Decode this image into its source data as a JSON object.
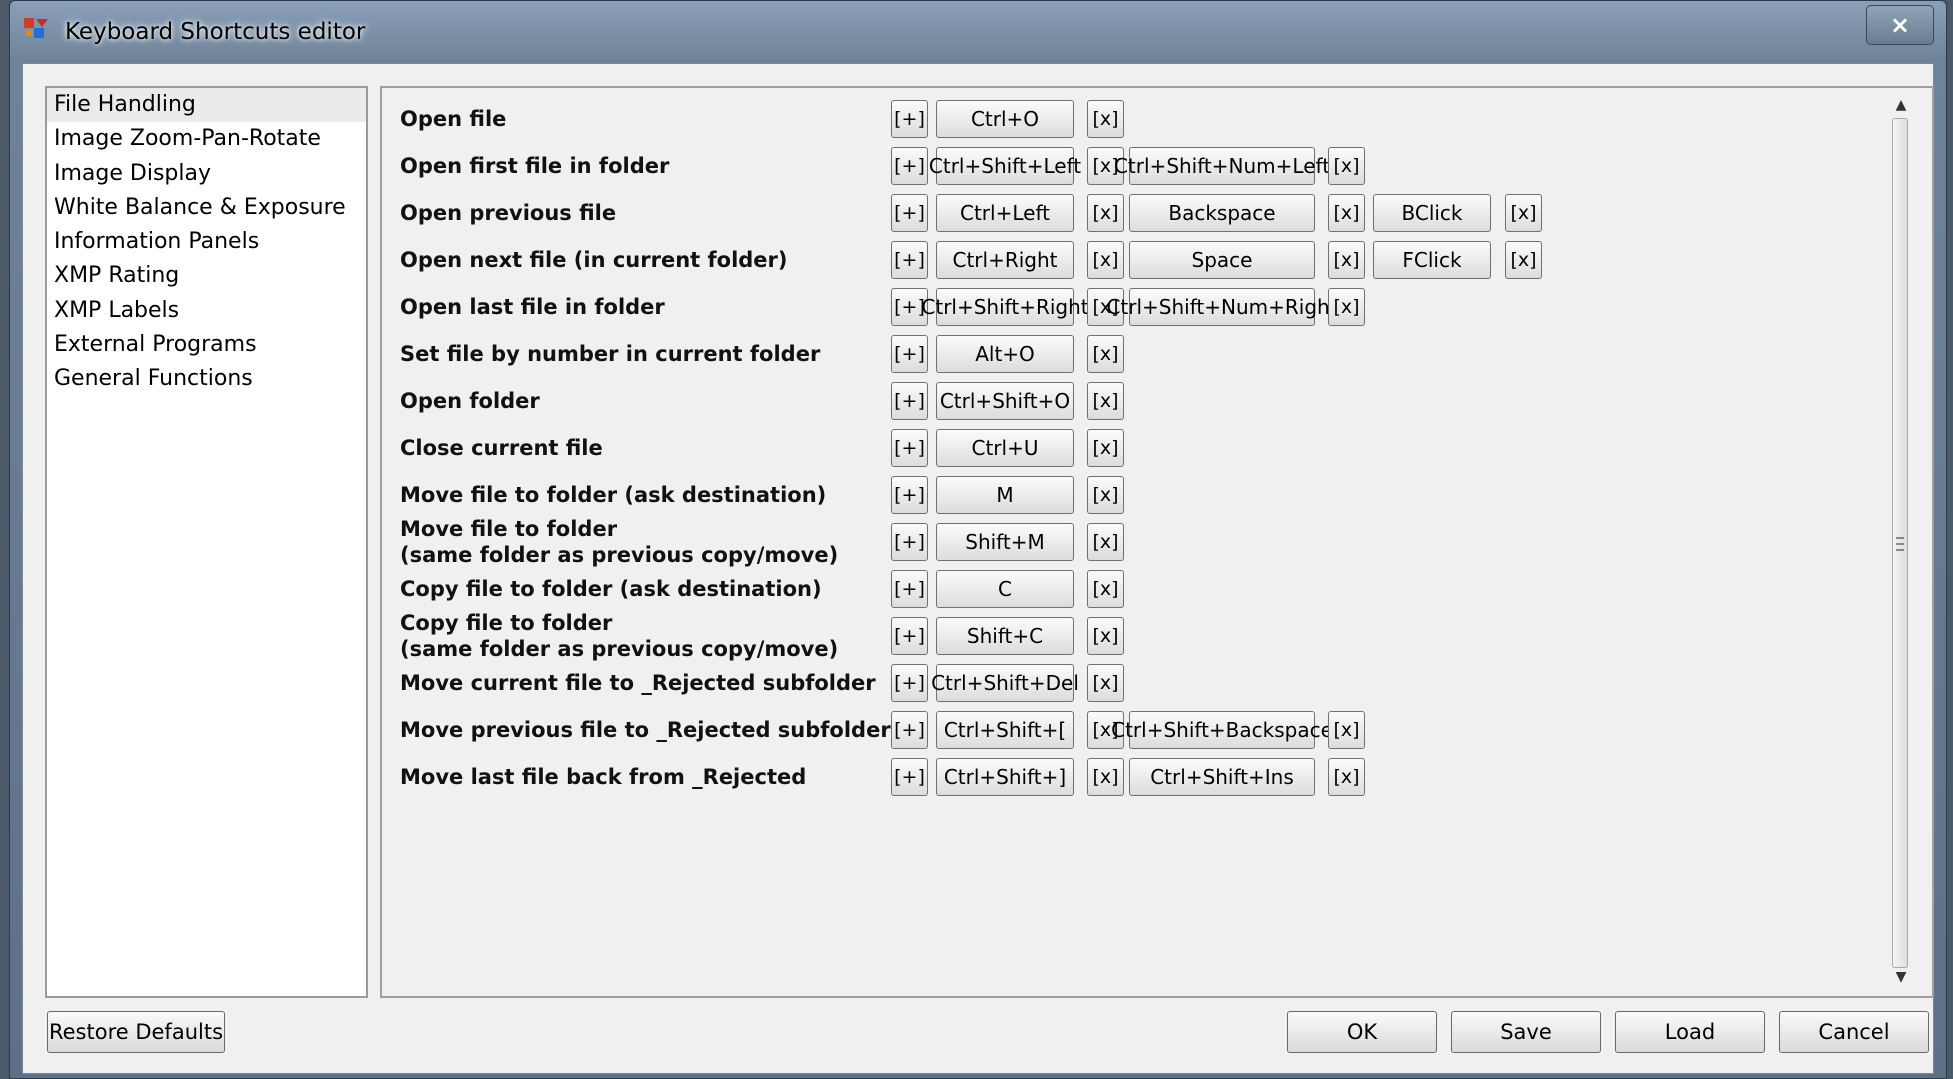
{
  "window": {
    "title": "Keyboard Shortcuts editor",
    "close_label": "×"
  },
  "categories": [
    "File Handling",
    "Image Zoom-Pan-Rotate",
    "Image Display",
    "White Balance & Exposure",
    "Information Panels",
    "XMP Rating",
    "XMP Labels",
    "External Programs",
    "General Functions"
  ],
  "selected_category": "File Handling",
  "add_label": "[+]",
  "remove_label": "[x]",
  "shortcuts": [
    {
      "label": "Open file",
      "keys": [
        "Ctrl+O"
      ]
    },
    {
      "label": "Open first file in folder",
      "keys": [
        "Ctrl+Shift+Left",
        "Ctrl+Shift+Num+Left"
      ]
    },
    {
      "label": "Open previous file",
      "keys": [
        "Ctrl+Left",
        "Backspace",
        "BClick"
      ]
    },
    {
      "label": "Open next file (in current folder)",
      "keys": [
        "Ctrl+Right",
        "Space",
        "FClick"
      ]
    },
    {
      "label": "Open last file in folder",
      "keys": [
        "Ctrl+Shift+Right",
        "Ctrl+Shift+Num+Right"
      ]
    },
    {
      "label": "Set file by number in current folder",
      "keys": [
        "Alt+O"
      ]
    },
    {
      "label": "Open folder",
      "keys": [
        "Ctrl+Shift+O"
      ]
    },
    {
      "label": "Close current file",
      "keys": [
        "Ctrl+U"
      ]
    },
    {
      "label": "Move file to folder (ask destination)",
      "keys": [
        "M"
      ]
    },
    {
      "label": "Move file to folder\n(same folder as previous copy/move)",
      "keys": [
        "Shift+M"
      ]
    },
    {
      "label": "Copy file to folder (ask destination)",
      "keys": [
        "C"
      ]
    },
    {
      "label": "Copy file to folder\n(same folder as previous copy/move)",
      "keys": [
        "Shift+C"
      ]
    },
    {
      "label": "Move current file to _Rejected subfolder",
      "keys": [
        "Ctrl+Shift+Del"
      ]
    },
    {
      "label": "Move previous file to _Rejected subfolder",
      "keys": [
        "Ctrl+Shift+[",
        "Ctrl+Shift+Backspace"
      ]
    },
    {
      "label": "Move last file back from _Rejected",
      "keys": [
        "Ctrl+Shift+]",
        "Ctrl+Shift+Ins"
      ]
    }
  ],
  "buttons": {
    "restore_defaults": "Restore Defaults",
    "ok": "OK",
    "save": "Save",
    "load": "Load",
    "cancel": "Cancel"
  },
  "scroll_position": 0.0
}
